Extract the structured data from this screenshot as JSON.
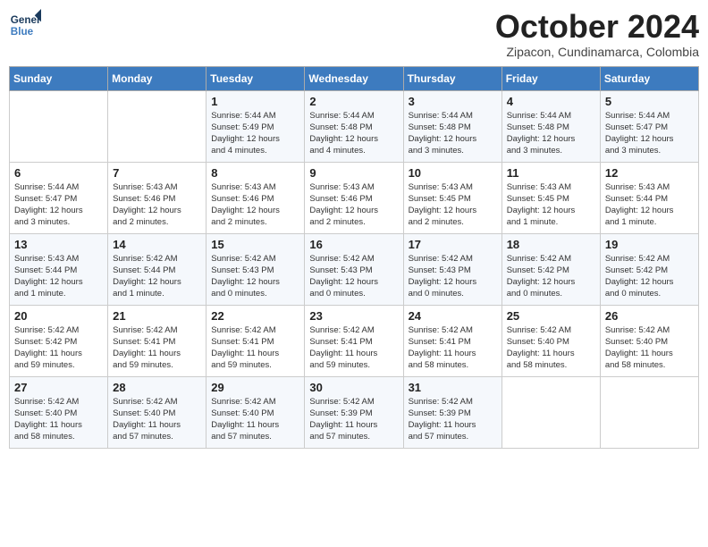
{
  "logo": {
    "line1": "General",
    "line2": "Blue"
  },
  "title": "October 2024",
  "subtitle": "Zipacon, Cundinamarca, Colombia",
  "days_of_week": [
    "Sunday",
    "Monday",
    "Tuesday",
    "Wednesday",
    "Thursday",
    "Friday",
    "Saturday"
  ],
  "weeks": [
    [
      {
        "day": "",
        "info": ""
      },
      {
        "day": "",
        "info": ""
      },
      {
        "day": "1",
        "info": "Sunrise: 5:44 AM\nSunset: 5:49 PM\nDaylight: 12 hours\nand 4 minutes."
      },
      {
        "day": "2",
        "info": "Sunrise: 5:44 AM\nSunset: 5:48 PM\nDaylight: 12 hours\nand 4 minutes."
      },
      {
        "day": "3",
        "info": "Sunrise: 5:44 AM\nSunset: 5:48 PM\nDaylight: 12 hours\nand 3 minutes."
      },
      {
        "day": "4",
        "info": "Sunrise: 5:44 AM\nSunset: 5:48 PM\nDaylight: 12 hours\nand 3 minutes."
      },
      {
        "day": "5",
        "info": "Sunrise: 5:44 AM\nSunset: 5:47 PM\nDaylight: 12 hours\nand 3 minutes."
      }
    ],
    [
      {
        "day": "6",
        "info": "Sunrise: 5:44 AM\nSunset: 5:47 PM\nDaylight: 12 hours\nand 3 minutes."
      },
      {
        "day": "7",
        "info": "Sunrise: 5:43 AM\nSunset: 5:46 PM\nDaylight: 12 hours\nand 2 minutes."
      },
      {
        "day": "8",
        "info": "Sunrise: 5:43 AM\nSunset: 5:46 PM\nDaylight: 12 hours\nand 2 minutes."
      },
      {
        "day": "9",
        "info": "Sunrise: 5:43 AM\nSunset: 5:46 PM\nDaylight: 12 hours\nand 2 minutes."
      },
      {
        "day": "10",
        "info": "Sunrise: 5:43 AM\nSunset: 5:45 PM\nDaylight: 12 hours\nand 2 minutes."
      },
      {
        "day": "11",
        "info": "Sunrise: 5:43 AM\nSunset: 5:45 PM\nDaylight: 12 hours\nand 1 minute."
      },
      {
        "day": "12",
        "info": "Sunrise: 5:43 AM\nSunset: 5:44 PM\nDaylight: 12 hours\nand 1 minute."
      }
    ],
    [
      {
        "day": "13",
        "info": "Sunrise: 5:43 AM\nSunset: 5:44 PM\nDaylight: 12 hours\nand 1 minute."
      },
      {
        "day": "14",
        "info": "Sunrise: 5:42 AM\nSunset: 5:44 PM\nDaylight: 12 hours\nand 1 minute."
      },
      {
        "day": "15",
        "info": "Sunrise: 5:42 AM\nSunset: 5:43 PM\nDaylight: 12 hours\nand 0 minutes."
      },
      {
        "day": "16",
        "info": "Sunrise: 5:42 AM\nSunset: 5:43 PM\nDaylight: 12 hours\nand 0 minutes."
      },
      {
        "day": "17",
        "info": "Sunrise: 5:42 AM\nSunset: 5:43 PM\nDaylight: 12 hours\nand 0 minutes."
      },
      {
        "day": "18",
        "info": "Sunrise: 5:42 AM\nSunset: 5:42 PM\nDaylight: 12 hours\nand 0 minutes."
      },
      {
        "day": "19",
        "info": "Sunrise: 5:42 AM\nSunset: 5:42 PM\nDaylight: 12 hours\nand 0 minutes."
      }
    ],
    [
      {
        "day": "20",
        "info": "Sunrise: 5:42 AM\nSunset: 5:42 PM\nDaylight: 11 hours\nand 59 minutes."
      },
      {
        "day": "21",
        "info": "Sunrise: 5:42 AM\nSunset: 5:41 PM\nDaylight: 11 hours\nand 59 minutes."
      },
      {
        "day": "22",
        "info": "Sunrise: 5:42 AM\nSunset: 5:41 PM\nDaylight: 11 hours\nand 59 minutes."
      },
      {
        "day": "23",
        "info": "Sunrise: 5:42 AM\nSunset: 5:41 PM\nDaylight: 11 hours\nand 59 minutes."
      },
      {
        "day": "24",
        "info": "Sunrise: 5:42 AM\nSunset: 5:41 PM\nDaylight: 11 hours\nand 58 minutes."
      },
      {
        "day": "25",
        "info": "Sunrise: 5:42 AM\nSunset: 5:40 PM\nDaylight: 11 hours\nand 58 minutes."
      },
      {
        "day": "26",
        "info": "Sunrise: 5:42 AM\nSunset: 5:40 PM\nDaylight: 11 hours\nand 58 minutes."
      }
    ],
    [
      {
        "day": "27",
        "info": "Sunrise: 5:42 AM\nSunset: 5:40 PM\nDaylight: 11 hours\nand 58 minutes."
      },
      {
        "day": "28",
        "info": "Sunrise: 5:42 AM\nSunset: 5:40 PM\nDaylight: 11 hours\nand 57 minutes."
      },
      {
        "day": "29",
        "info": "Sunrise: 5:42 AM\nSunset: 5:40 PM\nDaylight: 11 hours\nand 57 minutes."
      },
      {
        "day": "30",
        "info": "Sunrise: 5:42 AM\nSunset: 5:39 PM\nDaylight: 11 hours\nand 57 minutes."
      },
      {
        "day": "31",
        "info": "Sunrise: 5:42 AM\nSunset: 5:39 PM\nDaylight: 11 hours\nand 57 minutes."
      },
      {
        "day": "",
        "info": ""
      },
      {
        "day": "",
        "info": ""
      }
    ]
  ]
}
